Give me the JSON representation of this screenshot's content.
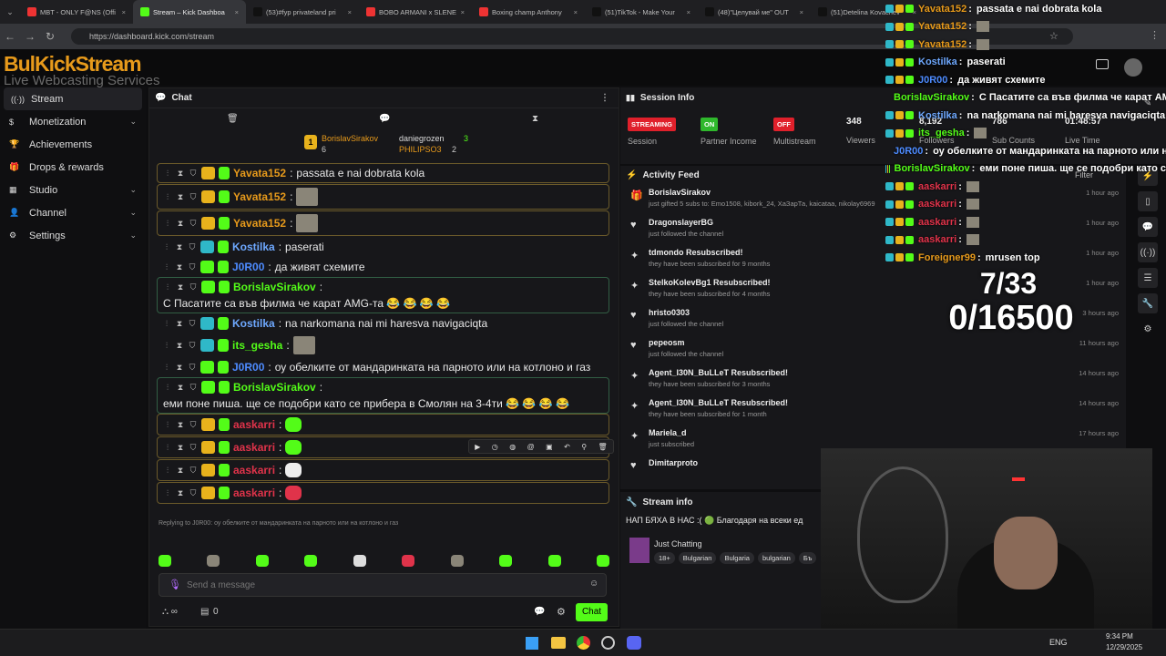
{
  "tabs": [
    {
      "label": "MBT - ONLY F@NS (Offi",
      "color": "#e33"
    },
    {
      "label": "Stream – Kick Dashboa",
      "color": "#53fc18",
      "active": true
    },
    {
      "label": "(53)#fyp privateland pri",
      "color": "#111"
    },
    {
      "label": "BOBO ARMANI x SLENE",
      "color": "#e33"
    },
    {
      "label": "Boxing champ Anthony",
      "color": "#e33"
    },
    {
      "label": "(51)TikTok - Make Your",
      "color": "#111"
    },
    {
      "label": "(48)\"Целувай ме\" OUT",
      "color": "#111"
    },
    {
      "label": "(51)Detelina Kovachev",
      "color": "#111"
    }
  ],
  "url": "https://dashboard.kick.com/stream",
  "logo": {
    "main": "BulKickStream",
    "sub": "Live Webcasting Services"
  },
  "sidebar": [
    {
      "label": "Stream",
      "icon": "broadcast-icon",
      "active": true
    },
    {
      "label": "Monetization",
      "icon": "dollar-icon",
      "chev": true
    },
    {
      "label": "Achievements",
      "icon": "trophy-icon"
    },
    {
      "label": "Drops & rewards",
      "icon": "gift-icon"
    },
    {
      "label": "Studio",
      "icon": "studio-icon",
      "chev": true
    },
    {
      "label": "Channel",
      "icon": "user-icon",
      "chev": true
    },
    {
      "label": "Settings",
      "icon": "gear-icon",
      "chev": true
    }
  ],
  "chat": {
    "title": "Chat",
    "gifters": {
      "first": {
        "name": "BorislavSirakov",
        "count": "6"
      },
      "second": {
        "name": "daniegrozen",
        "count": "3"
      },
      "third": {
        "name": "PHILIPSO3",
        "count": "2"
      }
    },
    "messages": [
      {
        "user": "Yavata152",
        "color": "#e79a1b",
        "text": "passata e nai dobrata kola",
        "hl": "gold"
      },
      {
        "user": "Yavata152",
        "color": "#e79a1b",
        "text": "",
        "img": true,
        "hl": "gold"
      },
      {
        "user": "Yavata152",
        "color": "#e79a1b",
        "text": "",
        "img": true,
        "hl": "gold"
      },
      {
        "user": "Kostilka",
        "color": "#6ea8fe",
        "text": "paserati"
      },
      {
        "user": "J0R00",
        "color": "#4d8bff",
        "text": "да живят схемите"
      },
      {
        "user": "BorislavSirakov",
        "color": "#53fc18",
        "text": "С Пасатите са във филма че карат AMG-та 😂 😂 😂 😂",
        "hl": "green"
      },
      {
        "user": "Kostilka",
        "color": "#6ea8fe",
        "text": "na narkomana nai mi haresva navigaciqta"
      },
      {
        "user": "its_gesha",
        "color": "#53fc18",
        "text": "",
        "img": true
      },
      {
        "user": "J0R00",
        "color": "#4d8bff",
        "text": "оу обелките от мандаринката на парното или на котлоно и газ"
      },
      {
        "user": "BorislavSirakov",
        "color": "#53fc18",
        "text": "еми поне пиша. ще се подобри като се прибера в Смолян на 3-4ти 😂 😂 😂 😂",
        "hl": "green"
      },
      {
        "user": "aaskarri",
        "color": "#e0334a",
        "text": "",
        "emote": true,
        "hl": "gold"
      },
      {
        "user": "aaskarri",
        "color": "#e0334a",
        "text": "",
        "emote": true,
        "hl": "gold"
      },
      {
        "user": "aaskarri",
        "color": "#e0334a",
        "text": "",
        "emote": true,
        "hl": "gold"
      },
      {
        "user": "aaskarri",
        "color": "#e0334a",
        "text": "",
        "emote": true,
        "hl": "gold"
      },
      {
        "user": "Foreigner99",
        "color": "#e79a1b",
        "text": "mrusen top"
      }
    ],
    "reply_label": "Replying to J0R00: оу обелките от мандаринката на парното или на котлоно и газ",
    "placeholder": "Send a message",
    "count": "0",
    "chat_button": "Chat"
  },
  "session": {
    "title": "Session Info",
    "stats": [
      {
        "badge": "STREAMING",
        "badge_color": "#e0202b",
        "label": "Session"
      },
      {
        "badge": "ON",
        "badge_color": "#2fb82c",
        "label": "Partner Income"
      },
      {
        "badge": "OFF",
        "badge_color": "#e0202b",
        "label": "Multistream"
      },
      {
        "value": "348",
        "label": "Viewers"
      },
      {
        "value": "8,192",
        "label": "Followers"
      },
      {
        "value": "786",
        "label": "Sub Counts"
      },
      {
        "value": "01:48:57",
        "label": "Live Time"
      }
    ]
  },
  "feed": {
    "title": "Activity Feed",
    "filter": "Filter",
    "items": [
      {
        "icon": "gift-icon",
        "title": "BorislavSirakov",
        "sub": "just gifted 5 subs to: Emo1508, kibork_24, ХаЗарТа, kaicataa, nikolay6969",
        "time": "1 hour ago"
      },
      {
        "icon": "heart-icon",
        "title": "DragonslayerBG",
        "sub": "just followed the channel",
        "time": "1 hour ago"
      },
      {
        "icon": "star-icon",
        "title": "tdmondo Resubscribed!",
        "sub": "they have been subscribed for 9 months",
        "time": "1 hour ago"
      },
      {
        "icon": "star-icon",
        "title": "StelkoKolevBg1 Resubscribed!",
        "sub": "they have been subscribed for 4 months",
        "time": "1 hour ago"
      },
      {
        "icon": "heart-icon",
        "title": "hristo0303",
        "sub": "just followed the channel",
        "time": "3 hours ago"
      },
      {
        "icon": "heart-icon",
        "title": "pepeosm",
        "sub": "just followed the channel",
        "time": "11 hours ago"
      },
      {
        "icon": "star-icon",
        "title": "Agent_I30N_BuLLeT Resubscribed!",
        "sub": "they have been subscribed for 3 months",
        "time": "14 hours ago"
      },
      {
        "icon": "star-icon",
        "title": "Agent_I30N_BuLLeT Resubscribed!",
        "sub": "they have been subscribed for 1 month",
        "time": "14 hours ago"
      },
      {
        "icon": "star-icon",
        "title": "Mariela_d",
        "sub": "just subscribed",
        "time": "17 hours ago"
      },
      {
        "icon": "heart-icon",
        "title": "Dimitarproto",
        "sub": "",
        "time": ""
      }
    ]
  },
  "stream_info": {
    "title": "Stream info",
    "stream_title": "НАП БЯХА В НАС :( 🟢 Благодаря на всеки ед",
    "category": "Just Chatting",
    "tags": [
      "18+",
      "Bulgarian",
      "Bulgaria",
      "bulgarian",
      "Бъ"
    ]
  },
  "overlay": {
    "lines": [
      {
        "user": "Yavata152",
        "color": "#e79a1b",
        "text": "passata e nai dobrata kola"
      },
      {
        "user": "Yavata152",
        "color": "#e79a1b",
        "text": ""
      },
      {
        "user": "Yavata152",
        "color": "#e79a1b",
        "text": ""
      },
      {
        "user": "Kostilka",
        "color": "#6ea8fe",
        "text": "paserati"
      },
      {
        "user": "J0R00",
        "color": "#4d8bff",
        "text": "да живят схемите"
      },
      {
        "user": "BorislavSirakov",
        "color": "#53fc18",
        "text": "С Пасатите са във филма че карат AMG"
      },
      {
        "user": "Kostilka",
        "color": "#6ea8fe",
        "text": "na narkomana nai mi haresva navigaciqta"
      },
      {
        "user": "its_gesha",
        "color": "#53fc18",
        "text": ""
      },
      {
        "user": "J0R00",
        "color": "#4d8bff",
        "text": "оу обелките от мандаринката на парното или на"
      },
      {
        "user": "BorislavSirakov",
        "color": "#53fc18",
        "text": "еми поне пиша. ще се подобри като с"
      },
      {
        "user": "aaskarri",
        "color": "#e0334a",
        "text": ""
      },
      {
        "user": "aaskarri",
        "color": "#e0334a",
        "text": ""
      },
      {
        "user": "aaskarri",
        "color": "#e0334a",
        "text": ""
      },
      {
        "user": "aaskarri",
        "color": "#e0334a",
        "text": ""
      },
      {
        "user": "Foreigner99",
        "color": "#e79a1b",
        "text": "mrusen top"
      }
    ],
    "goal1": "7/33",
    "goal2": "0/16500"
  },
  "taskbar": {
    "lang": "ENG",
    "time": "9:34 PM",
    "date": "12/29/2025"
  }
}
